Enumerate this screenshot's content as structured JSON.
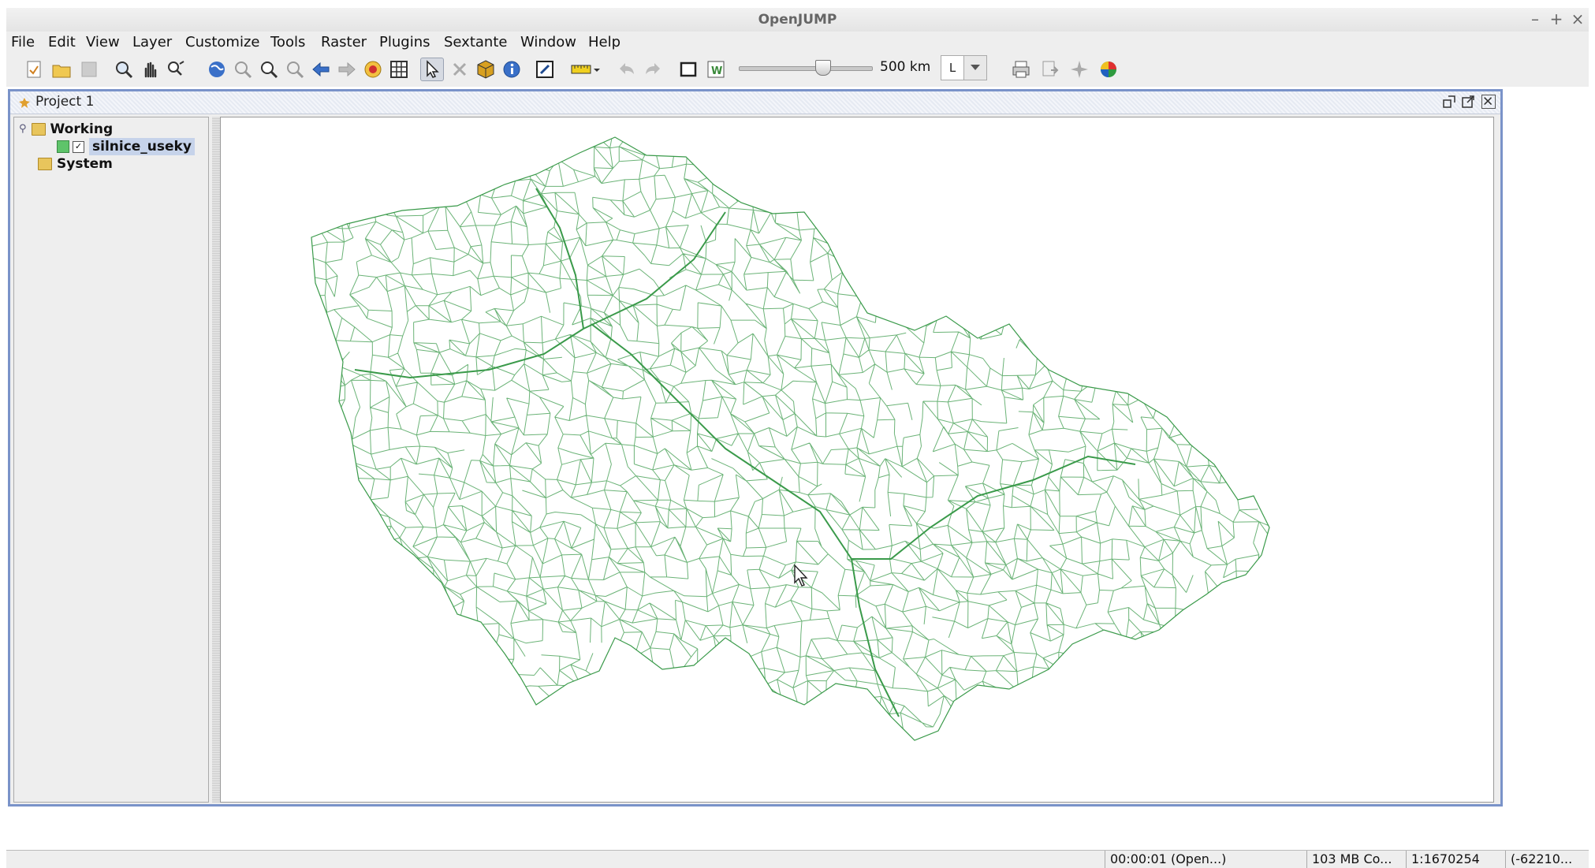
{
  "window": {
    "title": "OpenJUMP"
  },
  "menu": [
    "File",
    "Edit",
    "View",
    "Layer",
    "Customize",
    "Tools",
    "Raster",
    "Plugins",
    "Sextante",
    "Window",
    "Help"
  ],
  "toolbar": {
    "scale_label": "500 km",
    "scale_unit": "L"
  },
  "project": {
    "title": "Project 1",
    "tree": {
      "working_label": "Working",
      "layer_name": "silnice_useky",
      "layer_checked": true,
      "layer_color": "#5ec46a",
      "system_label": "System"
    }
  },
  "map": {
    "feature_color": "#3a9a4a"
  },
  "status": {
    "timer": "00:00:01 (Open...)",
    "memory": "103 MB Co...",
    "scale": "1:1670254",
    "coords": "(-62210..."
  }
}
